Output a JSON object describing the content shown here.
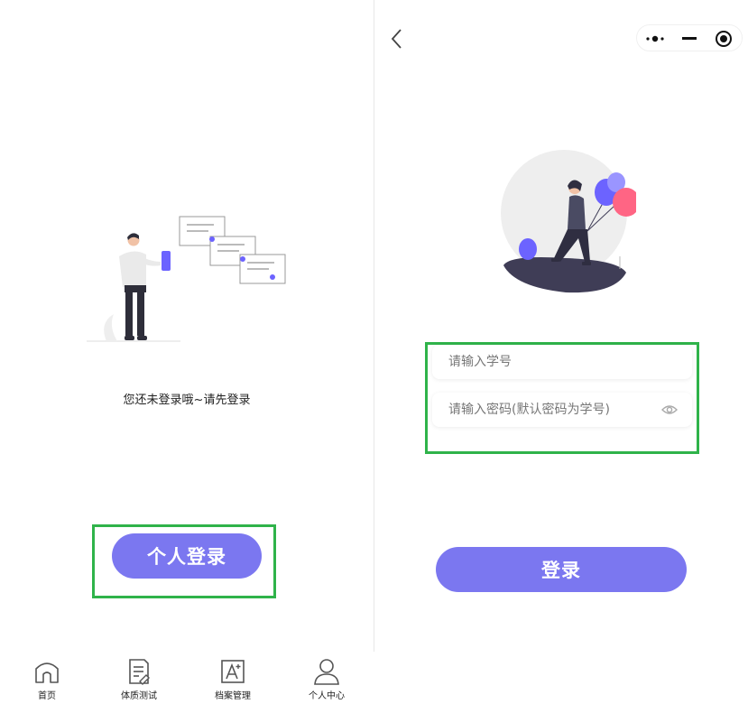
{
  "left": {
    "empty_message": "您还未登录哦~请先登录",
    "login_button": "个人登录"
  },
  "tabbar": {
    "items": [
      {
        "label": "首页",
        "icon": "home-icon"
      },
      {
        "label": "体质测试",
        "icon": "document-icon"
      },
      {
        "label": "档案管理",
        "icon": "font-a-plus-icon"
      },
      {
        "label": "个人中心",
        "icon": "user-icon"
      }
    ]
  },
  "right": {
    "student_id": {
      "placeholder": "请输入学号",
      "value": ""
    },
    "password": {
      "placeholder": "请输入密码(默认密码为学号)",
      "value": ""
    },
    "login_button": "登录"
  },
  "colors": {
    "accent": "#7b77f0",
    "highlight": "#2fb34a"
  }
}
